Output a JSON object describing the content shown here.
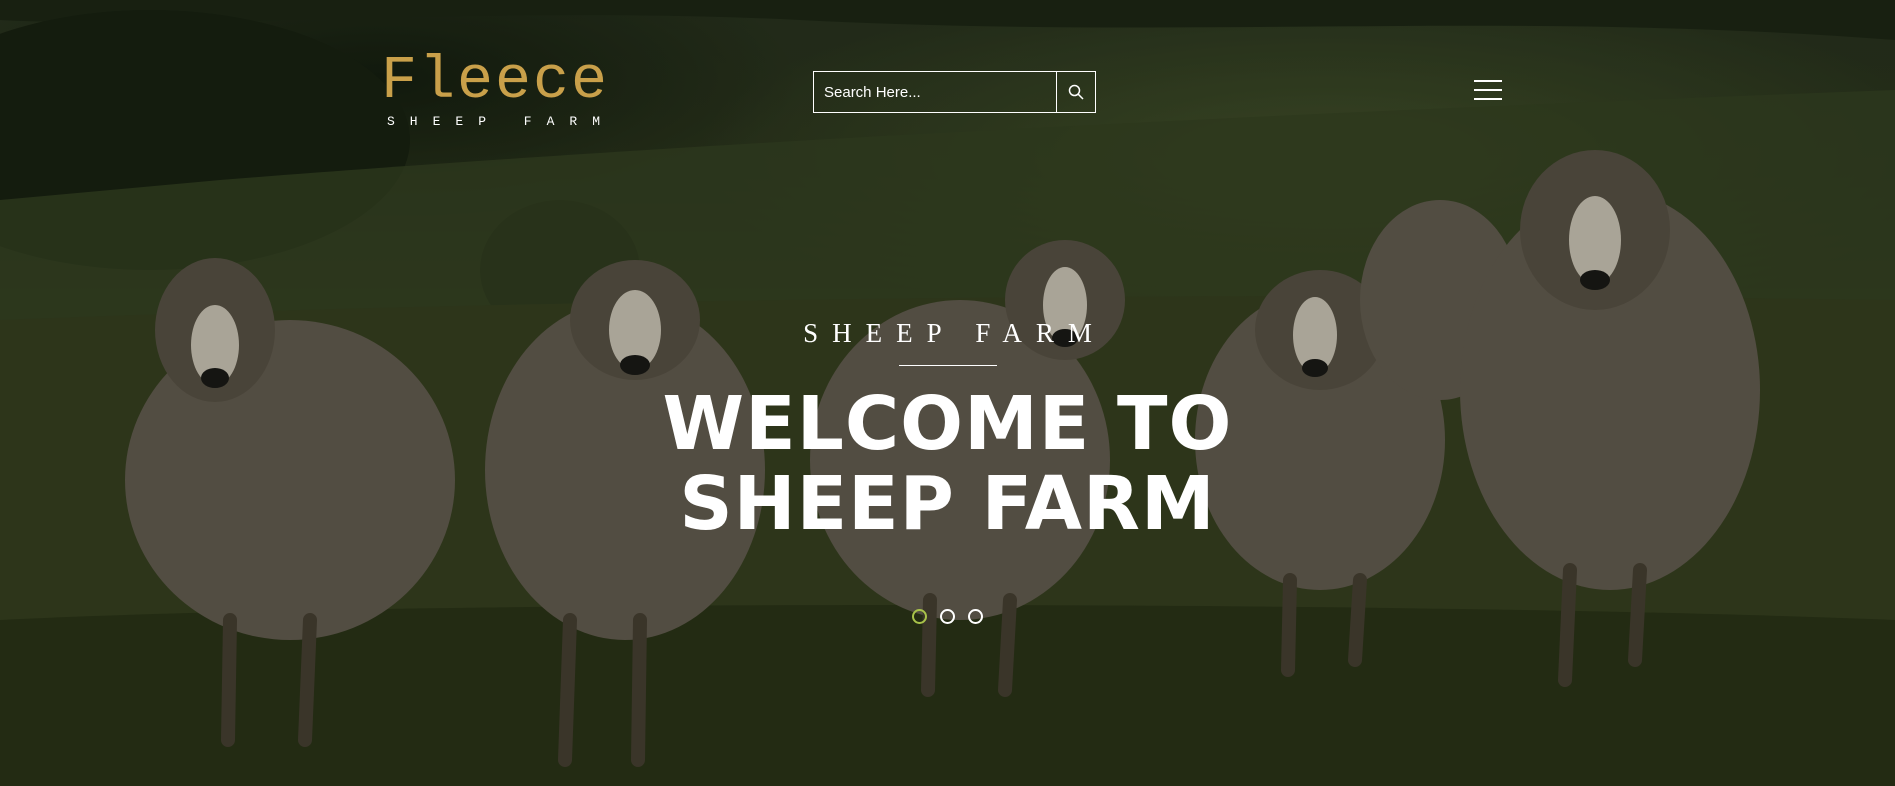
{
  "logo": {
    "title": "Fleece",
    "subtitle": "SHEEP FARM"
  },
  "search": {
    "placeholder": "Search Here..."
  },
  "icons": {
    "search": "search-icon",
    "menu": "hamburger-menu-icon"
  },
  "hero": {
    "eyebrow": "SHEEP FARM",
    "headline_line1": "WELCOME TO",
    "headline_line2": "SHEEP FARM"
  },
  "slider": {
    "slide_count": 3,
    "active_index": 0
  },
  "colors": {
    "brand_gold": "#c9a04a",
    "active_dot": "#a8c24a",
    "text": "#ffffff"
  }
}
